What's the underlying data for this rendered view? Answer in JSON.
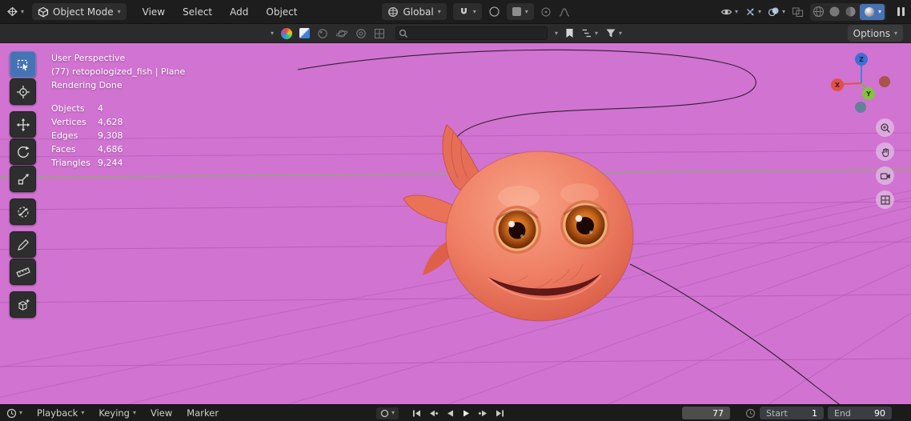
{
  "icons": {
    "chevron": "▾"
  },
  "topbar": {
    "mode_label": "Object Mode",
    "menus": [
      "View",
      "Select",
      "Add",
      "Object"
    ],
    "orientation_label": "Global"
  },
  "toolbar2": {
    "search_placeholder": "",
    "options_label": "Options"
  },
  "viewport": {
    "overlay": {
      "line1": "User Perspective",
      "line2": "(77) retopologized_fish | Plane",
      "line3": "Rendering Done"
    },
    "stats": [
      {
        "label": "Objects",
        "value": "4"
      },
      {
        "label": "Vertices",
        "value": "4,628"
      },
      {
        "label": "Edges",
        "value": "9,308"
      },
      {
        "label": "Faces",
        "value": "4,686"
      },
      {
        "label": "Triangles",
        "value": "9,244"
      }
    ],
    "gizmo": {
      "x": "X",
      "y": "Y",
      "z": "Z"
    },
    "colors": {
      "viewport_bg": "#d173d1",
      "active_tool": "#4772b4",
      "fish_body": "#ee8168",
      "eye_iris": "#c96a1e",
      "axis_x": "#e25045",
      "axis_y": "#84c13f",
      "axis_z": "#3e6fd4"
    }
  },
  "timeline": {
    "menus": [
      "Playback",
      "Keying",
      "View",
      "Marker"
    ],
    "current_frame": "77",
    "start_label": "Start",
    "start_value": "1",
    "end_label": "End",
    "end_value": "90"
  }
}
